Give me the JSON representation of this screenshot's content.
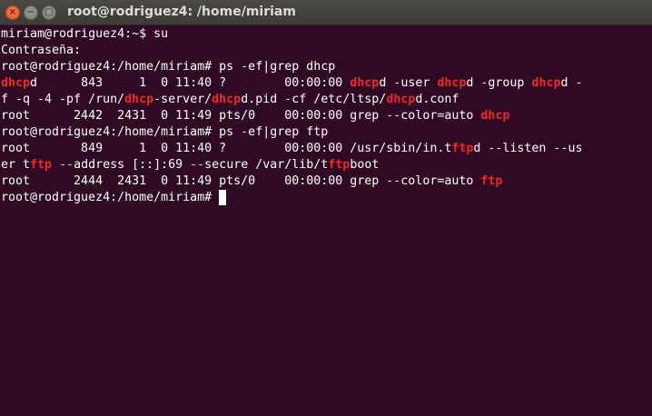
{
  "window": {
    "title": "root@rodriguez4: /home/miriam",
    "close_glyph": "×",
    "minimize_glyph": "−",
    "maximize_glyph": "□"
  },
  "colors": {
    "background": "#300a24",
    "text": "#ffffff",
    "highlight": "#ef2929"
  },
  "terminal": {
    "lines": [
      [
        {
          "t": "miriam@rodriguez4:~$ su",
          "h": false
        }
      ],
      [
        {
          "t": "Contraseña:",
          "h": false
        }
      ],
      [
        {
          "t": "root@rodriguez4:/home/miriam# ps -ef|grep dhcp",
          "h": false
        }
      ],
      [
        {
          "t": "dhcp",
          "h": true
        },
        {
          "t": "d      843     1  0 11:40 ?        00:00:00 ",
          "h": false
        },
        {
          "t": "dhcp",
          "h": true
        },
        {
          "t": "d -user ",
          "h": false
        },
        {
          "t": "dhcp",
          "h": true
        },
        {
          "t": "d -group ",
          "h": false
        },
        {
          "t": "dhcp",
          "h": true
        },
        {
          "t": "d -",
          "h": false
        }
      ],
      [
        {
          "t": "f -q -4 -pf /run/",
          "h": false
        },
        {
          "t": "dhcp",
          "h": true
        },
        {
          "t": "-server/",
          "h": false
        },
        {
          "t": "dhcp",
          "h": true
        },
        {
          "t": "d.pid -cf /etc/ltsp/",
          "h": false
        },
        {
          "t": "dhcp",
          "h": true
        },
        {
          "t": "d.conf",
          "h": false
        }
      ],
      [
        {
          "t": "root      2442  2431  0 11:49 pts/0    00:00:00 grep --color=auto ",
          "h": false
        },
        {
          "t": "dhcp",
          "h": true
        }
      ],
      [
        {
          "t": "root@rodriguez4:/home/miriam# ps -ef|grep ftp",
          "h": false
        }
      ],
      [
        {
          "t": "root       849     1  0 11:40 ?        00:00:00 /usr/sbin/in.t",
          "h": false
        },
        {
          "t": "ftp",
          "h": true
        },
        {
          "t": "d --listen --us",
          "h": false
        }
      ],
      [
        {
          "t": "er t",
          "h": false
        },
        {
          "t": "ftp",
          "h": true
        },
        {
          "t": " --address [::]:69 --secure /var/lib/t",
          "h": false
        },
        {
          "t": "ftp",
          "h": true
        },
        {
          "t": "boot",
          "h": false
        }
      ],
      [
        {
          "t": "root      2444  2431  0 11:49 pts/0    00:00:00 grep --color=auto ",
          "h": false
        },
        {
          "t": "ftp",
          "h": true
        }
      ],
      [
        {
          "t": "root@rodriguez4:/home/miriam# ",
          "h": false
        }
      ]
    ]
  }
}
